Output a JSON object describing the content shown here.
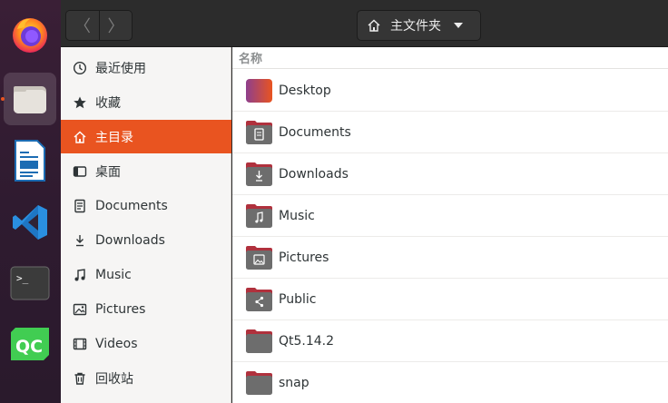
{
  "window": {
    "path_label": "主文件夹",
    "back_glyph": "〈",
    "forward_glyph": "〉"
  },
  "dock": {
    "apps": [
      {
        "name": "firefox",
        "icon": "firefox-icon"
      },
      {
        "name": "files",
        "icon": "files-icon",
        "active": true
      },
      {
        "name": "libreoffice-writer",
        "icon": "writer-icon"
      },
      {
        "name": "vscode",
        "icon": "vscode-icon"
      },
      {
        "name": "terminal",
        "icon": "terminal-icon"
      },
      {
        "name": "qt-creator",
        "icon": "qtcreator-icon"
      }
    ],
    "accent": "#e95420"
  },
  "sidebar": {
    "items": [
      {
        "label": "最近使用",
        "icon": "clock-icon"
      },
      {
        "label": "收藏",
        "icon": "star-icon"
      },
      {
        "label": "主目录",
        "icon": "home-icon",
        "selected": true
      },
      {
        "label": "桌面",
        "icon": "desktop-icon"
      },
      {
        "label": "Documents",
        "icon": "document-icon"
      },
      {
        "label": "Downloads",
        "icon": "download-icon"
      },
      {
        "label": "Music",
        "icon": "music-icon"
      },
      {
        "label": "Pictures",
        "icon": "picture-icon"
      },
      {
        "label": "Videos",
        "icon": "video-icon"
      },
      {
        "label": "回收站",
        "icon": "trash-icon"
      }
    ]
  },
  "main": {
    "column_name": "名称",
    "files": [
      {
        "name": "Desktop",
        "icon": "desktop-folder-icon"
      },
      {
        "name": "Documents",
        "icon": "documents-folder-icon"
      },
      {
        "name": "Downloads",
        "icon": "downloads-folder-icon"
      },
      {
        "name": "Music",
        "icon": "music-folder-icon"
      },
      {
        "name": "Pictures",
        "icon": "pictures-folder-icon"
      },
      {
        "name": "Public",
        "icon": "public-folder-icon"
      },
      {
        "name": "Qt5.14.2",
        "icon": "folder-icon"
      },
      {
        "name": "snap",
        "icon": "folder-icon"
      }
    ]
  }
}
